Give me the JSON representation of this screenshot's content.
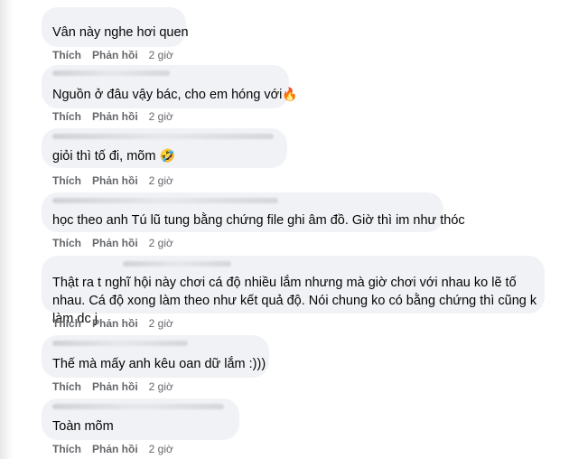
{
  "actions": {
    "like": "Thích",
    "reply": "Phản hồi"
  },
  "comments": [
    {
      "text": "Vân này nghe hơi quen",
      "time": "2 giờ"
    },
    {
      "text": "Nguồn ở đâu vậy bác, cho em hóng với",
      "emoji": "🔥",
      "time": "2 giờ"
    },
    {
      "text": "giỏi thì tố đi, mõm",
      "emoji": "🤣",
      "time": "2 giờ"
    },
    {
      "text": "học theo anh Tú lũ tung bằng chứng file ghi âm đồ. Giờ thì im như thóc",
      "time": "2 giờ"
    },
    {
      "text": "Thật ra t nghĩ hội này chơi cá độ nhiều lắm nhưng mà giờ chơi với nhau ko lẽ tố nhau. Cá độ xong làm theo như kết quả độ. Nói chung ko có bằng chứng thì cũng k làm dc j",
      "time": "2 giờ"
    },
    {
      "text": "Thế mà mấy anh kêu oan dữ lắm :)))",
      "time": "2 giờ"
    },
    {
      "text": "Toàn mõm",
      "time": "2 giờ"
    }
  ]
}
